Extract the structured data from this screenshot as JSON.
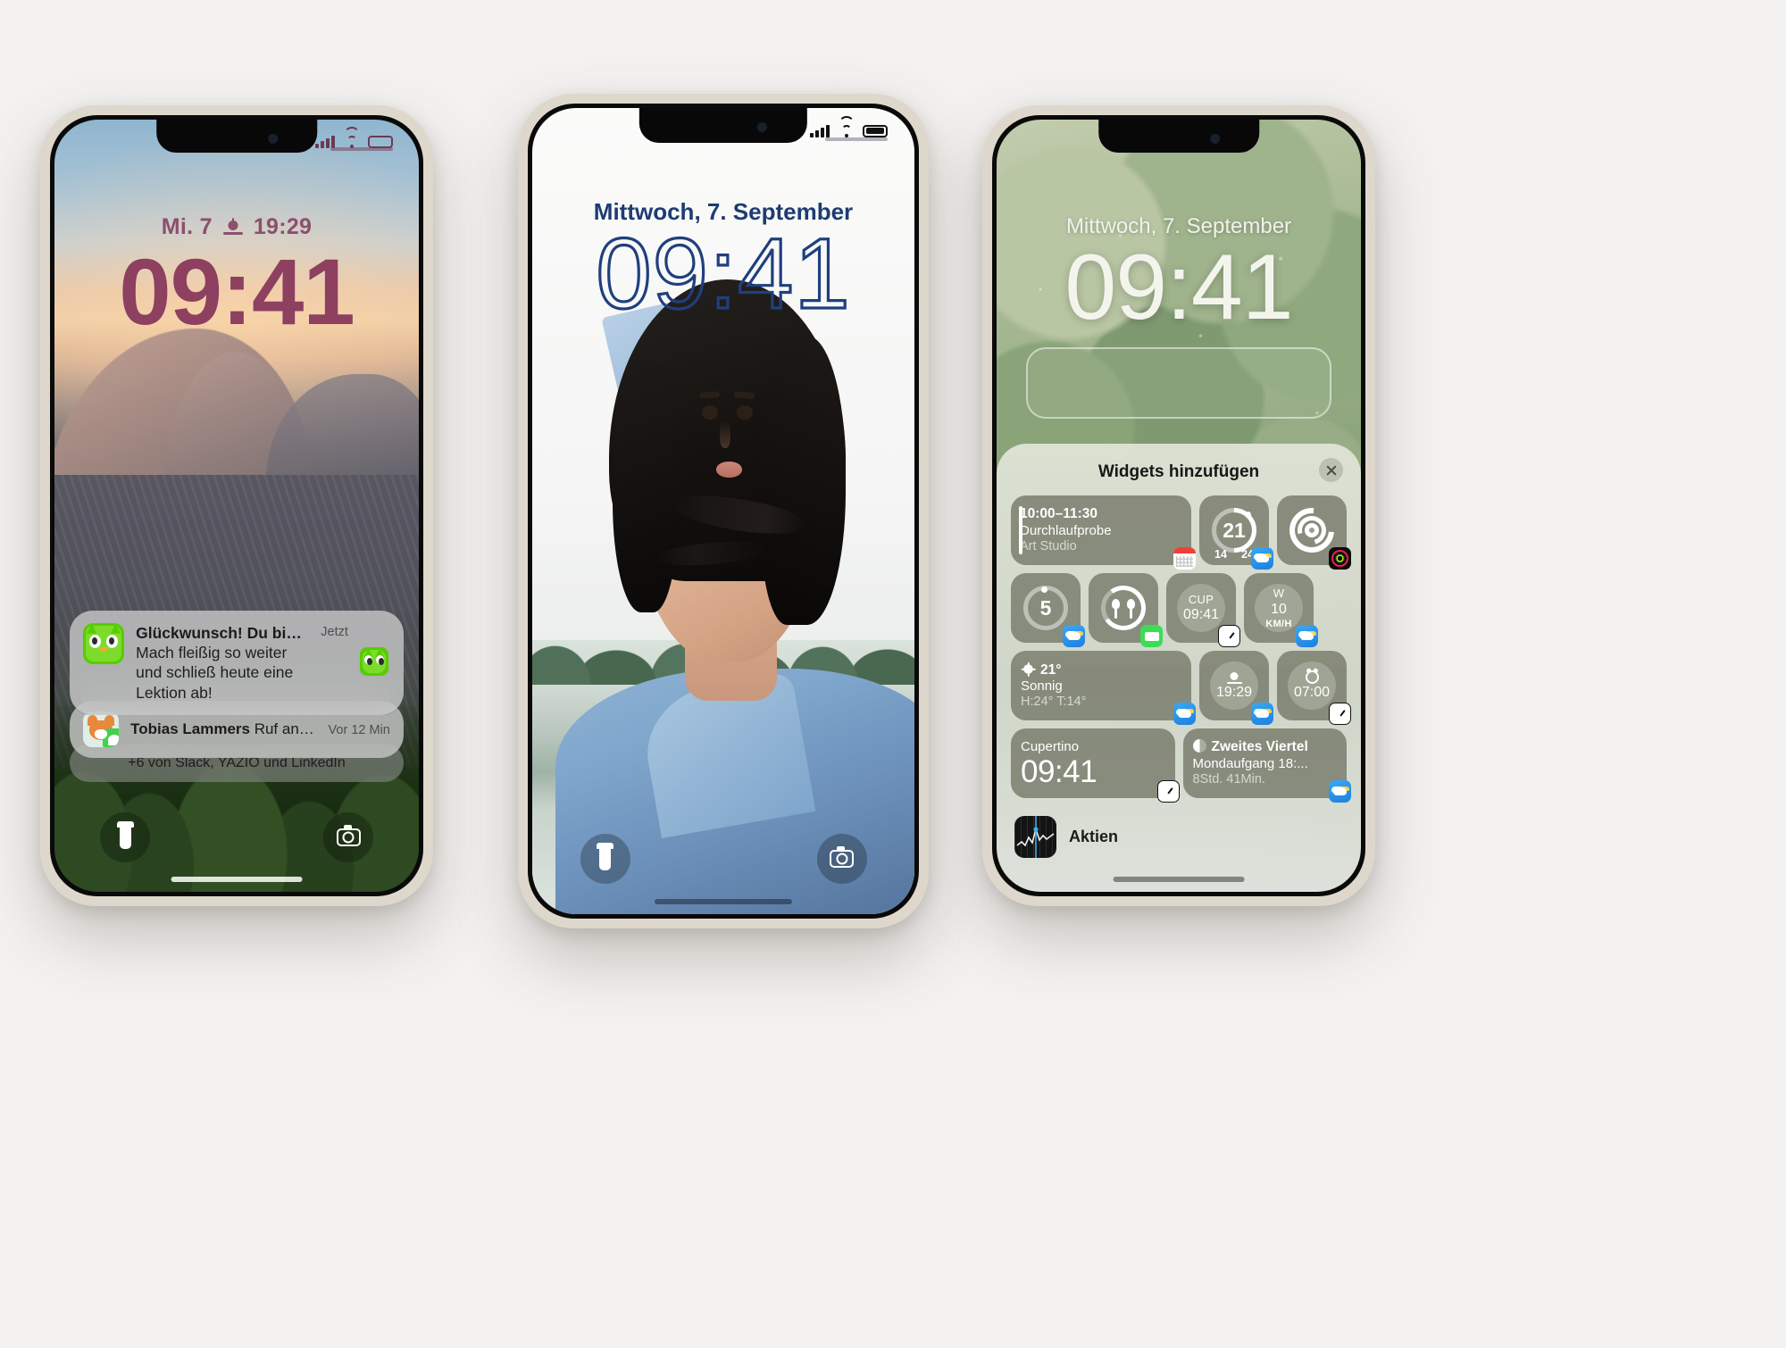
{
  "phone1": {
    "name": "lock-screen-yosemite",
    "statusbar": {
      "signal": "signal-bars",
      "wifi": "wifi-icon",
      "battery": "battery-icon"
    },
    "date": "Mi. 7",
    "sunset_time": "19:29",
    "time": "09:41",
    "accent_color": "#8d4060",
    "notifications": [
      {
        "app": "Duolingo",
        "title": "Glückwunsch! Du bist wieder auf...",
        "body": "Mach fleißig so weiter und schließ heute eine Lektion ab!",
        "time": "Jetzt"
      },
      {
        "app": "Nachrichten",
        "sender": "Tobias Lammers",
        "preview": "Ruf an, wenn...",
        "time": "Vor 12 Min"
      }
    ],
    "more_notifications": "+6 von Slack, YAZIO und LinkedIn",
    "controls": {
      "left": "flashlight-button",
      "right": "camera-button"
    }
  },
  "phone2": {
    "name": "lock-screen-portrait",
    "statusbar": {
      "signal": "signal-bars",
      "wifi": "wifi-icon",
      "battery": "battery-icon"
    },
    "date": "Mittwoch, 7. September",
    "time": "09:41",
    "accent_color": "#1f3f7e",
    "controls": {
      "left": "flashlight-button",
      "right": "camera-button"
    }
  },
  "phone3": {
    "name": "lock-screen-widget-picker",
    "date": "Mittwoch, 7. September",
    "time": "09:41",
    "sheet": {
      "title": "Widgets hinzufügen",
      "close": "close-icon",
      "rows": [
        [
          {
            "type": "wide",
            "kind": "calendar",
            "line1": "10:00–11:30",
            "line2": "Durchlaufprobe",
            "line3": "Art Studio",
            "badge": "calendar-app-icon"
          },
          {
            "type": "square",
            "kind": "temp-ring",
            "value": "21",
            "min": "14",
            "max": "24",
            "badge": "weather-app-icon"
          },
          {
            "type": "square",
            "kind": "fitness-rings",
            "badge": "fitness-app-icon"
          }
        ],
        [
          {
            "type": "square",
            "kind": "uv-ring",
            "value": "5",
            "badge": "weather-app-icon"
          },
          {
            "type": "square",
            "kind": "airpods-battery",
            "badge": "battery-app-icon"
          },
          {
            "type": "square",
            "kind": "world-clock",
            "line1": "CUP",
            "line2": "09:41",
            "badge": "clock-app-icon"
          },
          {
            "type": "square",
            "kind": "wind",
            "line1": "W",
            "line2": "10",
            "line3": "KM/H",
            "badge": "weather-app-icon"
          }
        ],
        [
          {
            "type": "wide",
            "kind": "weather-conditions",
            "line1": "21°",
            "line2": "Sonnig",
            "line3": "H:24° T:14°",
            "badge": "weather-app-icon"
          },
          {
            "type": "square",
            "kind": "sunset",
            "value": "19:29",
            "badge": "weather-app-icon"
          },
          {
            "type": "square",
            "kind": "alarm",
            "value": "07:00",
            "badge": "clock-app-icon"
          }
        ],
        [
          {
            "type": "wide",
            "kind": "city-clock",
            "line1": "Cupertino",
            "line2": "09:41",
            "badge": "clock-app-icon"
          },
          {
            "type": "wide",
            "kind": "moon-phase",
            "line1": "Zweites Viertel",
            "line2": "Mondaufgang 18:...",
            "line3": "8Std. 41Min.",
            "badge": "weather-app-icon"
          }
        ]
      ],
      "footer": {
        "app_icon": "stocks-app-icon",
        "label": "Aktien"
      }
    }
  }
}
